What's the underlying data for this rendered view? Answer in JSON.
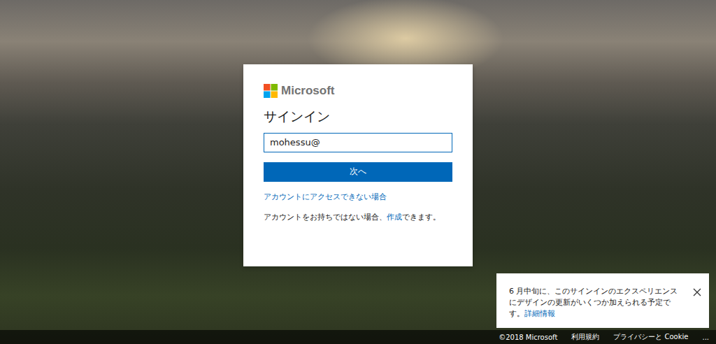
{
  "brand": {
    "name": "Microsoft"
  },
  "signin": {
    "title": "サインイン",
    "email": {
      "value": "mohessu@",
      "focused": true
    },
    "next_button": "次へ",
    "cant_access_link": "アカウントにアクセスできない場合",
    "no_account": {
      "before": "アカウントをお持ちではない場合、",
      "link": "作成",
      "after": "できます。"
    }
  },
  "notice": {
    "text": "6 月中旬に、このサインインのエクスペリエンスにデザインの更新がいくつか加えられる予定です。",
    "link": "詳細情報"
  },
  "footer": {
    "links": [
      "©2018 Microsoft",
      "利用規約",
      "プライバシーと Cookie"
    ],
    "more": "..."
  }
}
